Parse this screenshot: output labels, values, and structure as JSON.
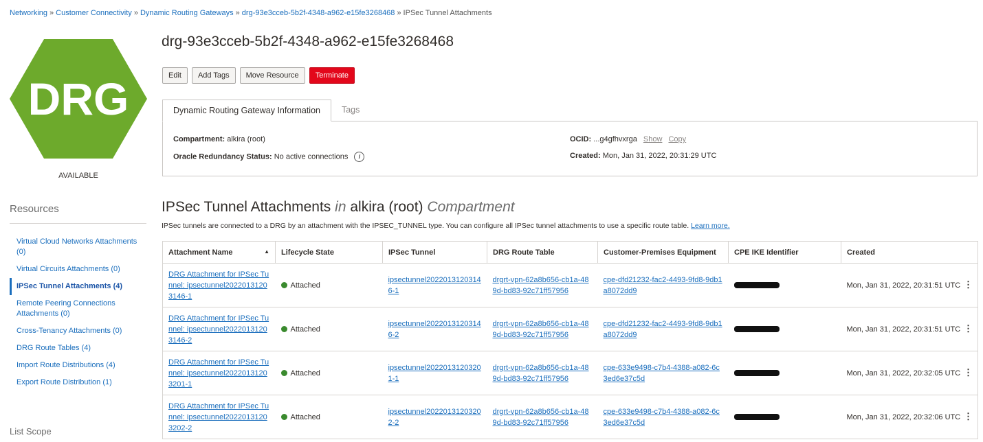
{
  "breadcrumb": {
    "items": [
      "Networking",
      "Customer Connectivity",
      "Dynamic Routing Gateways",
      "drg-93e3cceb-5b2f-4348-a962-e15fe3268468"
    ],
    "current": "IPSec Tunnel Attachments",
    "separator": "»"
  },
  "logo": {
    "text": "DRG",
    "color": "#6daa2c",
    "icon": "drg-hexagon-icon"
  },
  "status": "AVAILABLE",
  "page_title": "drg-93e3cceb-5b2f-4348-a962-e15fe3268468",
  "actions": {
    "edit": "Edit",
    "add_tags": "Add Tags",
    "move_resource": "Move Resource",
    "terminate": "Terminate"
  },
  "info_tabs": [
    "Dynamic Routing Gateway Information",
    "Tags"
  ],
  "info": {
    "compartment_label": "Compartment:",
    "compartment_value": "alkira (root)",
    "redundancy_label": "Oracle Redundancy Status:",
    "redundancy_value": "No active connections",
    "ocid_label": "OCID:",
    "ocid_value": "...g4gfhvxrga",
    "ocid_show": "Show",
    "ocid_copy": "Copy",
    "created_label": "Created:",
    "created_value": "Mon, Jan 31, 2022, 20:31:29 UTC"
  },
  "resources": {
    "title": "Resources",
    "items": [
      "Virtual Cloud Networks Attachments (0)",
      "Virtual Circuits Attachments (0)",
      "IPSec Tunnel Attachments (4)",
      "Remote Peering Connections Attachments (0)",
      "Cross-Tenancy Attachments (0)",
      "DRG Route Tables (4)",
      "Import Route Distributions (4)",
      "Export Route Distribution (1)"
    ],
    "active_index": 2
  },
  "list_scope": "List Scope",
  "section": {
    "title_main": "IPSec Tunnel Attachments",
    "title_in": "in",
    "title_compartment": "alkira (root)",
    "title_suffix": "Compartment",
    "description": "IPSec tunnels are connected to a DRG by an attachment with the IPSEC_TUNNEL type. You can configure all IPSec tunnel attachments to use a specific route table.",
    "learn_more": "Learn more."
  },
  "table": {
    "columns": [
      "Attachment Name",
      "Lifecycle State",
      "IPSec Tunnel",
      "DRG Route Table",
      "Customer-Premises Equipment",
      "CPE IKE Identifier",
      "Created"
    ],
    "sort_icon": "▲",
    "rows": [
      {
        "name": "DRG Attachment for IPSec Tunnel: ipsectunnel20220131203146-1",
        "state": "Attached",
        "tunnel": "ipsectunnel20220131203146-1",
        "route_table": "drgrt-vpn-62a8b656-cb1a-489d-bd83-92c71ff57956",
        "cpe": "cpe-dfd21232-fac2-4493-9fd8-9db1a8072dd9",
        "created": "Mon, Jan 31, 2022, 20:31:51 UTC"
      },
      {
        "name": "DRG Attachment for IPSec Tunnel: ipsectunnel20220131203146-2",
        "state": "Attached",
        "tunnel": "ipsectunnel20220131203146-2",
        "route_table": "drgrt-vpn-62a8b656-cb1a-489d-bd83-92c71ff57956",
        "cpe": "cpe-dfd21232-fac2-4493-9fd8-9db1a8072dd9",
        "created": "Mon, Jan 31, 2022, 20:31:51 UTC"
      },
      {
        "name": "DRG Attachment for IPSec Tunnel: ipsectunnel20220131203201-1",
        "state": "Attached",
        "tunnel": "ipsectunnel20220131203201-1",
        "route_table": "drgrt-vpn-62a8b656-cb1a-489d-bd83-92c71ff57956",
        "cpe": "cpe-633e9498-c7b4-4388-a082-6c3ed6e37c5d",
        "created": "Mon, Jan 31, 2022, 20:32:05 UTC"
      },
      {
        "name": "DRG Attachment for IPSec Tunnel: ipsectunnel20220131203202-2",
        "state": "Attached",
        "tunnel": "ipsectunnel20220131203202-2",
        "route_table": "drgrt-vpn-62a8b656-cb1a-489d-bd83-92c71ff57956",
        "cpe": "cpe-633e9498-c7b4-4388-a082-6c3ed6e37c5d",
        "created": "Mon, Jan 31, 2022, 20:32:06 UTC"
      }
    ]
  },
  "colors": {
    "brand_green": "#6daa2c",
    "link": "#1a6ebd",
    "danger": "#e3071b",
    "state_attached": "#3a8a2e"
  }
}
